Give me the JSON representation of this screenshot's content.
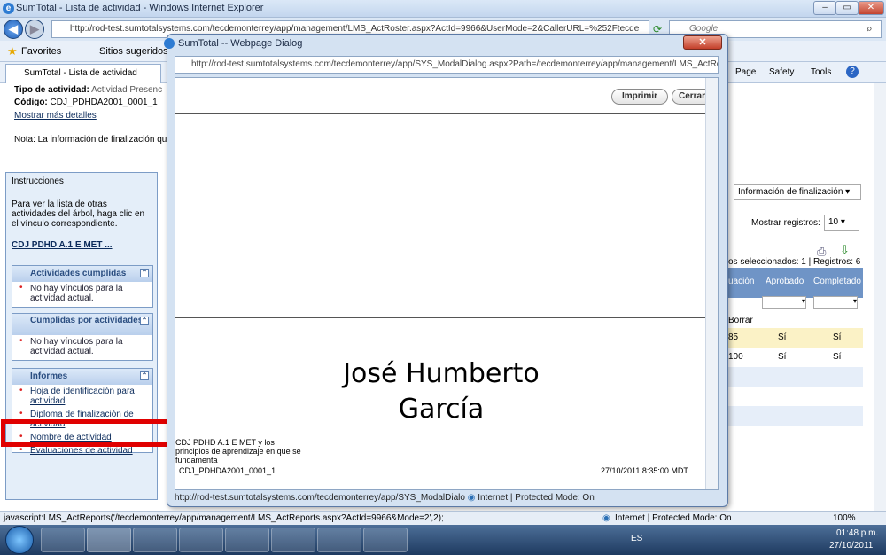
{
  "browser": {
    "title": "SumTotal - Lista de actividad - Windows Internet Explorer",
    "url": "http://rod-test.sumtotalsystems.com/tecdemonterrey/app/management/LMS_ActRoster.aspx?ActId=9966&UserMode=2&CallerURL=%252Ftecde",
    "search_placeholder": "Google",
    "favorites_label": "Favorites",
    "suggested_sites": "Sitios sugeridos",
    "tab_label": "SumTotal - Lista de actividad",
    "cmd_page": "Page",
    "cmd_safety": "Safety",
    "cmd_tools": "Tools",
    "status_left": "javascript:LMS_ActReports('/tecdemonterrey/app/management/LMS_ActReports.aspx?ActId=9966&Mode=2',2);",
    "status_zone": "Internet | Protected Mode: On",
    "zoom": "100%"
  },
  "page": {
    "tipo_label": "Tipo de actividad:",
    "tipo_value": "Actividad Presenc",
    "codigo_label": "Código:",
    "codigo_value": "CDJ_PDHDA2001_0001_1",
    "mostrar_detalles": "Mostrar más detalles",
    "nota": "Nota: La información de finalización qu",
    "dropdown_info": "Información de finalización",
    "mostrar_registros": "Mostrar registros:",
    "registros_value": "10",
    "seleccionados": "os seleccionados: 1 | Registros: 6",
    "col_evaluacion": "uación",
    "col_aprobado": "Aprobado",
    "col_completado": "Completado",
    "borrar": "Borrar",
    "rows": [
      {
        "score": "85",
        "aprobado": "Sí",
        "completado": "Sí"
      },
      {
        "score": "100",
        "aprobado": "Sí",
        "completado": "Sí"
      }
    ]
  },
  "left_panel": {
    "instructions_title": "Instrucciones",
    "instructions_text": "Para ver la lista de otras actividades del árbol, haga clic en el vínculo correspondiente.",
    "tree_link": "CDJ PDHD A.1 E MET ...",
    "box1_title": "Actividades cumplidas",
    "box1_text": "No hay vínculos para la actividad actual.",
    "box2_title": "Cumplidas por actividades",
    "box2_text": "No hay vínculos para la actividad actual.",
    "box3_title": "Informes",
    "reports": [
      "Hoja de identificación para actividad",
      "Diploma de finalización de actividad",
      "Nombre de actividad",
      "Evaluaciones de actividad"
    ]
  },
  "dialog": {
    "title": "SumTotal -- Webpage Dialog",
    "url": "http://rod-test.sumtotalsystems.com/tecdemonterrey/app/SYS_ModalDialog.aspx?Path=/tecdemonterrey/app/management/LMS_ActReports.asp",
    "print_label": "Imprimir",
    "close_label": "Cerrar",
    "name_line1": "José Humberto",
    "name_line2": "García",
    "activity_text": "CDJ PDHD A.1 E MET y los principios de aprendizaje en que se fundamenta",
    "activity_code": "CDJ_PDHDA2001_0001_1",
    "date": "27/10/2011 8:35:00 MDT",
    "status": "http://rod-test.sumtotalsystems.com/tecdemonterrey/app/SYS_ModalDialo",
    "status_zone": "Internet | Protected Mode: On"
  },
  "taskbar": {
    "lang": "ES",
    "time": "01:48 p.m.",
    "date": "27/10/2011"
  },
  "colors": {
    "highlight_box": "#e00000",
    "accent": "#2a4d80"
  }
}
